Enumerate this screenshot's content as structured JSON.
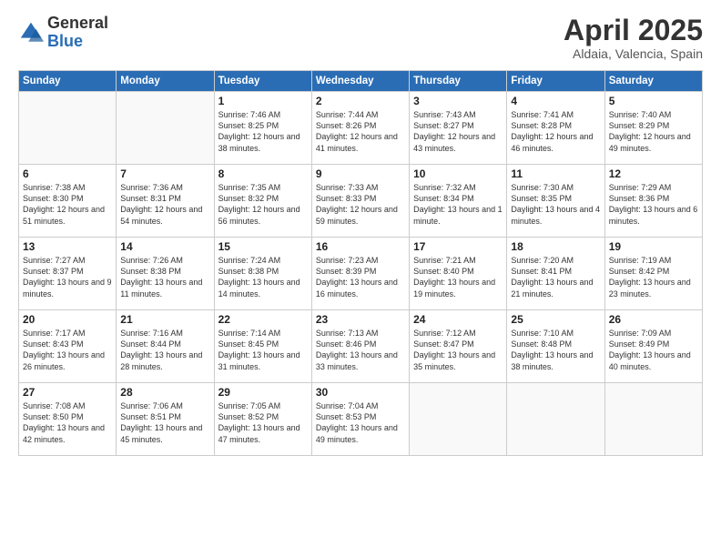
{
  "logo": {
    "general": "General",
    "blue": "Blue"
  },
  "title": "April 2025",
  "subtitle": "Aldaia, Valencia, Spain",
  "days_of_week": [
    "Sunday",
    "Monday",
    "Tuesday",
    "Wednesday",
    "Thursday",
    "Friday",
    "Saturday"
  ],
  "weeks": [
    [
      {
        "day": "",
        "info": ""
      },
      {
        "day": "",
        "info": ""
      },
      {
        "day": "1",
        "info": "Sunrise: 7:46 AM\nSunset: 8:25 PM\nDaylight: 12 hours and 38 minutes."
      },
      {
        "day": "2",
        "info": "Sunrise: 7:44 AM\nSunset: 8:26 PM\nDaylight: 12 hours and 41 minutes."
      },
      {
        "day": "3",
        "info": "Sunrise: 7:43 AM\nSunset: 8:27 PM\nDaylight: 12 hours and 43 minutes."
      },
      {
        "day": "4",
        "info": "Sunrise: 7:41 AM\nSunset: 8:28 PM\nDaylight: 12 hours and 46 minutes."
      },
      {
        "day": "5",
        "info": "Sunrise: 7:40 AM\nSunset: 8:29 PM\nDaylight: 12 hours and 49 minutes."
      }
    ],
    [
      {
        "day": "6",
        "info": "Sunrise: 7:38 AM\nSunset: 8:30 PM\nDaylight: 12 hours and 51 minutes."
      },
      {
        "day": "7",
        "info": "Sunrise: 7:36 AM\nSunset: 8:31 PM\nDaylight: 12 hours and 54 minutes."
      },
      {
        "day": "8",
        "info": "Sunrise: 7:35 AM\nSunset: 8:32 PM\nDaylight: 12 hours and 56 minutes."
      },
      {
        "day": "9",
        "info": "Sunrise: 7:33 AM\nSunset: 8:33 PM\nDaylight: 12 hours and 59 minutes."
      },
      {
        "day": "10",
        "info": "Sunrise: 7:32 AM\nSunset: 8:34 PM\nDaylight: 13 hours and 1 minute."
      },
      {
        "day": "11",
        "info": "Sunrise: 7:30 AM\nSunset: 8:35 PM\nDaylight: 13 hours and 4 minutes."
      },
      {
        "day": "12",
        "info": "Sunrise: 7:29 AM\nSunset: 8:36 PM\nDaylight: 13 hours and 6 minutes."
      }
    ],
    [
      {
        "day": "13",
        "info": "Sunrise: 7:27 AM\nSunset: 8:37 PM\nDaylight: 13 hours and 9 minutes."
      },
      {
        "day": "14",
        "info": "Sunrise: 7:26 AM\nSunset: 8:38 PM\nDaylight: 13 hours and 11 minutes."
      },
      {
        "day": "15",
        "info": "Sunrise: 7:24 AM\nSunset: 8:38 PM\nDaylight: 13 hours and 14 minutes."
      },
      {
        "day": "16",
        "info": "Sunrise: 7:23 AM\nSunset: 8:39 PM\nDaylight: 13 hours and 16 minutes."
      },
      {
        "day": "17",
        "info": "Sunrise: 7:21 AM\nSunset: 8:40 PM\nDaylight: 13 hours and 19 minutes."
      },
      {
        "day": "18",
        "info": "Sunrise: 7:20 AM\nSunset: 8:41 PM\nDaylight: 13 hours and 21 minutes."
      },
      {
        "day": "19",
        "info": "Sunrise: 7:19 AM\nSunset: 8:42 PM\nDaylight: 13 hours and 23 minutes."
      }
    ],
    [
      {
        "day": "20",
        "info": "Sunrise: 7:17 AM\nSunset: 8:43 PM\nDaylight: 13 hours and 26 minutes."
      },
      {
        "day": "21",
        "info": "Sunrise: 7:16 AM\nSunset: 8:44 PM\nDaylight: 13 hours and 28 minutes."
      },
      {
        "day": "22",
        "info": "Sunrise: 7:14 AM\nSunset: 8:45 PM\nDaylight: 13 hours and 31 minutes."
      },
      {
        "day": "23",
        "info": "Sunrise: 7:13 AM\nSunset: 8:46 PM\nDaylight: 13 hours and 33 minutes."
      },
      {
        "day": "24",
        "info": "Sunrise: 7:12 AM\nSunset: 8:47 PM\nDaylight: 13 hours and 35 minutes."
      },
      {
        "day": "25",
        "info": "Sunrise: 7:10 AM\nSunset: 8:48 PM\nDaylight: 13 hours and 38 minutes."
      },
      {
        "day": "26",
        "info": "Sunrise: 7:09 AM\nSunset: 8:49 PM\nDaylight: 13 hours and 40 minutes."
      }
    ],
    [
      {
        "day": "27",
        "info": "Sunrise: 7:08 AM\nSunset: 8:50 PM\nDaylight: 13 hours and 42 minutes."
      },
      {
        "day": "28",
        "info": "Sunrise: 7:06 AM\nSunset: 8:51 PM\nDaylight: 13 hours and 45 minutes."
      },
      {
        "day": "29",
        "info": "Sunrise: 7:05 AM\nSunset: 8:52 PM\nDaylight: 13 hours and 47 minutes."
      },
      {
        "day": "30",
        "info": "Sunrise: 7:04 AM\nSunset: 8:53 PM\nDaylight: 13 hours and 49 minutes."
      },
      {
        "day": "",
        "info": ""
      },
      {
        "day": "",
        "info": ""
      },
      {
        "day": "",
        "info": ""
      }
    ]
  ]
}
